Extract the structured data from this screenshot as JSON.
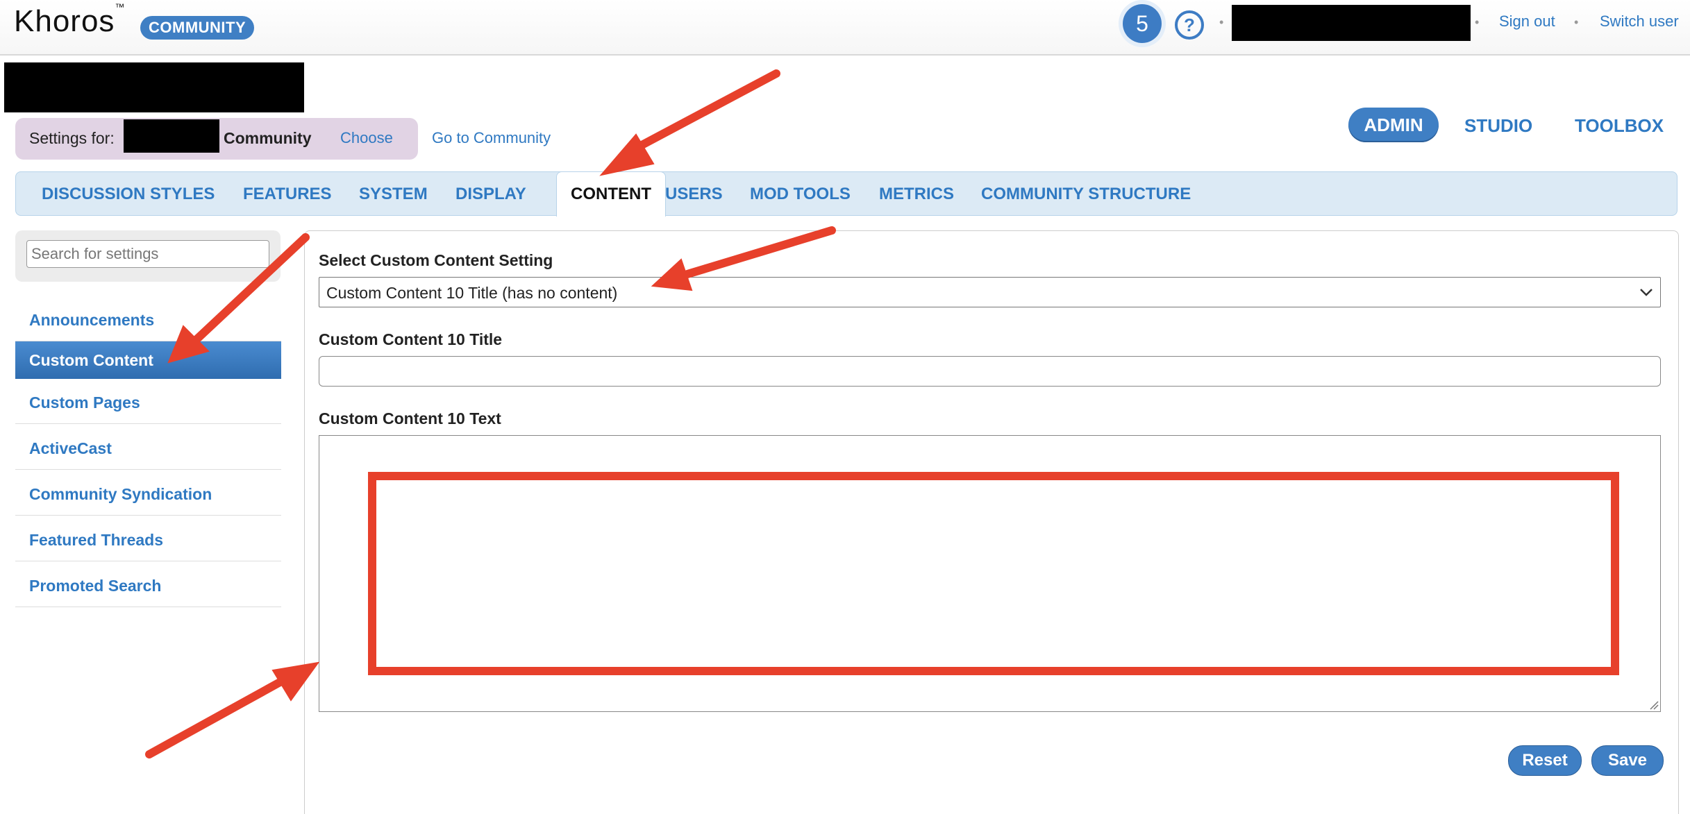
{
  "header": {
    "logo_text": "Khoros",
    "logo_tm": "™",
    "community_badge": "COMMUNITY",
    "notification_count": "5",
    "help_icon": "?",
    "separator": "•",
    "sign_out": "Sign out",
    "switch_user": "Switch user"
  },
  "settings_bar": {
    "settings_for_label": "Settings for:",
    "community_name": "Community",
    "choose_label": "Choose",
    "go_to_community": "Go to Community"
  },
  "top_tabs": {
    "admin": "ADMIN",
    "studio": "STUDIO",
    "toolbox": "TOOLBOX"
  },
  "main_nav": {
    "items": [
      "DISCUSSION STYLES",
      "FEATURES",
      "SYSTEM",
      "DISPLAY",
      "CONTENT",
      "USERS",
      "MOD TOOLS",
      "METRICS",
      "COMMUNITY STRUCTURE"
    ],
    "active": "CONTENT"
  },
  "sidebar": {
    "search_placeholder": "Search for settings",
    "items": [
      "Announcements",
      "Custom Content",
      "Custom Pages",
      "ActiveCast",
      "Community Syndication",
      "Featured Threads",
      "Promoted Search"
    ],
    "active": "Custom Content"
  },
  "form": {
    "select_label": "Select Custom Content Setting",
    "select_value": "Custom Content 10 Title (has no content)",
    "title_label": "Custom Content 10 Title",
    "title_value": "",
    "text_label": "Custom Content 10 Text",
    "text_value": "",
    "reset_button": "Reset",
    "save_button": "Save"
  },
  "annotation": {
    "arrow_color": "#e7402b",
    "highlight_color": "#e7402b"
  },
  "colors": {
    "link_blue": "#2f79c2",
    "button_blue": "#3f7fc4",
    "nav_bg": "#dceaf5",
    "settings_bg": "#e1d3e4"
  }
}
